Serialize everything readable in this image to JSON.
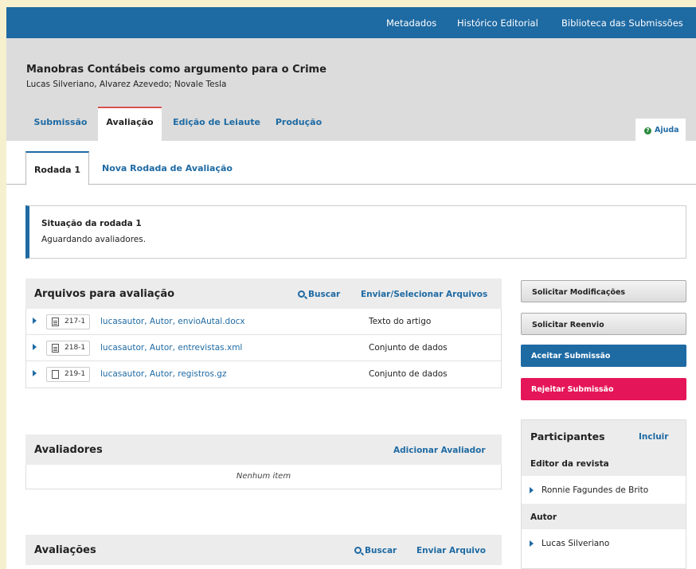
{
  "topnav": {
    "metadata": "Metadados",
    "history": "Histórico Editorial",
    "library": "Biblioteca das Submissões"
  },
  "submission": {
    "title": "Manobras Contábeis como argumento para o Crime",
    "authors": "Lucas Silveriano, Alvarez Azevedo; Novale Tesla"
  },
  "stages": [
    "Submissão",
    "Avaliação",
    "Edição de Leiaute",
    "Produção"
  ],
  "help_label": "Ajuda",
  "round_tabs": {
    "round1": "Rodada 1",
    "new_round": "Nova Rodada de Avaliação"
  },
  "round_status": {
    "heading": "Situação da rodada 1",
    "text": "Aguardando avaliadores."
  },
  "review_files": {
    "title": "Arquivos para avaliação",
    "search": "Buscar",
    "upload": "Enviar/Selecionar Arquivos",
    "files": [
      {
        "id": "217-1",
        "name": "lucasautor, Autor, envioAutal.docx",
        "type": "Texto do artigo",
        "icon": "document-icon"
      },
      {
        "id": "218-1",
        "name": "lucasautor, Autor, entrevistas.xml",
        "type": "Conjunto de dados",
        "icon": "document-icon"
      },
      {
        "id": "219-1",
        "name": "lucasautor, Autor, registros.gz",
        "type": "Conjunto de dados",
        "icon": "file-icon"
      }
    ]
  },
  "reviewers": {
    "title": "Avaliadores",
    "add": "Adicionar Avaliador",
    "empty": "Nenhum item"
  },
  "reviews": {
    "title": "Avaliações",
    "search": "Buscar",
    "upload": "Enviar Arquivo"
  },
  "actions": {
    "request_revisions": "Solicitar Modificações",
    "resubmit": "Solicitar Reenvio",
    "accept": "Aceitar Submissão",
    "decline": "Rejeitar Submissão"
  },
  "participants": {
    "title": "Participantes",
    "add": "Incluir",
    "groups": [
      {
        "role": "Editor da revista",
        "name": "Ronnie Fagundes de Brito"
      },
      {
        "role": "Autor",
        "name": "Lucas Silveriano"
      }
    ]
  },
  "colors": {
    "primary": "#1e6aa3",
    "accept": "#1e6aa3",
    "decline": "#e5155a",
    "active_tab_border": "#d9534f",
    "page_bg": "#f6f0cf"
  }
}
